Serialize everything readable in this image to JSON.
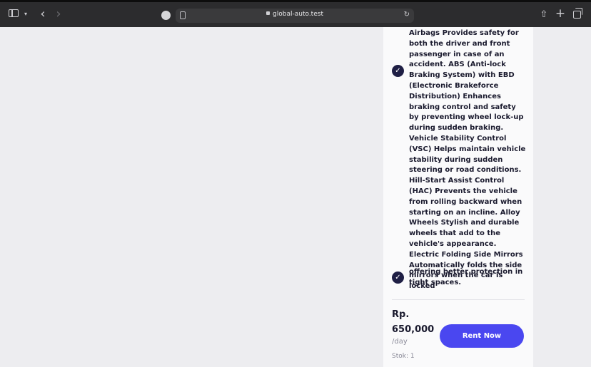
{
  "browser": {
    "url": "global-auto.test"
  },
  "product": {
    "features": [
      "Airbags Provides safety for both the driver and front passenger in case of an accident. ABS (Anti-lock Braking System) with EBD (Electronic Brakeforce Distribution) Enhances braking control and safety by preventing wheel lock-up during sudden braking. Vehicle Stability Control (VSC) Helps maintain vehicle stability during sudden steering or road conditions. Hill-Start Assist Control (HAC) Prevents the vehicle from rolling backward when starting on an incline. Alloy Wheels Stylish and durable wheels that add to the vehicle's appearance. Electric Folding Side Mirrors Automatically folds the side mirrors when the car is locked",
      "offering better protection in tight spaces."
    ],
    "price_prefix": "Rp.",
    "price_value": "650,000",
    "per_day": "/day",
    "stock": "Stok: 1",
    "rent_label": "Rent Now"
  },
  "colors": {
    "accent": "#4a47f0",
    "check": "#1f1f45"
  },
  "icons": [
    "sidebar-icon",
    "chevron-down-icon",
    "back-icon",
    "forward-icon",
    "lock-icon",
    "reload-icon",
    "share-icon",
    "plus-icon",
    "tabs-icon",
    "check-icon"
  ]
}
